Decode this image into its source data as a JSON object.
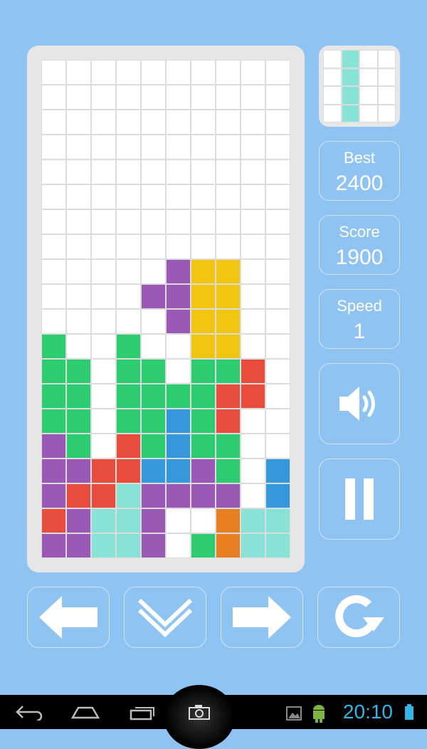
{
  "colors": {
    "background": "#8ec3f2",
    "empty": "#ffffff",
    "G": "#2ecc71",
    "P": "#9b59b6",
    "R": "#e74c3c",
    "B": "#3498db",
    "Y": "#f1c40f",
    "C": "#88e3d6",
    "O": "#e67e22"
  },
  "board": {
    "rows": [
      "..........",
      "..........",
      "..........",
      "..........",
      "..........",
      "..........",
      "..........",
      "..........",
      ".....PYY..",
      "....PPYY..",
      ".....PYY..",
      "G..G..YY..",
      "GG.GG.GGR.",
      "GG.GGGGRR.",
      "GG.GGBGR..",
      "PG.RGBGG..",
      "PPRRBBPG.B",
      "PRRCPPPP.B",
      "RPCCP..OCC",
      "PPCCP.GOCC"
    ]
  },
  "next_piece": {
    "rows": [
      ".C..",
      ".C..",
      ".C..",
      ".C.."
    ]
  },
  "stats": {
    "best_label": "Best",
    "best_value": "2400",
    "score_label": "Score",
    "score_value": "1900",
    "speed_label": "Speed",
    "speed_value": "1"
  },
  "controls": {
    "sound_icon": "speaker-icon",
    "pause_icon": "pause-icon",
    "left_icon": "arrow-left-icon",
    "down_icon": "chevron-down-icon",
    "right_icon": "arrow-right-icon",
    "rotate_icon": "rotate-icon"
  },
  "status_bar": {
    "time": "20:10"
  }
}
